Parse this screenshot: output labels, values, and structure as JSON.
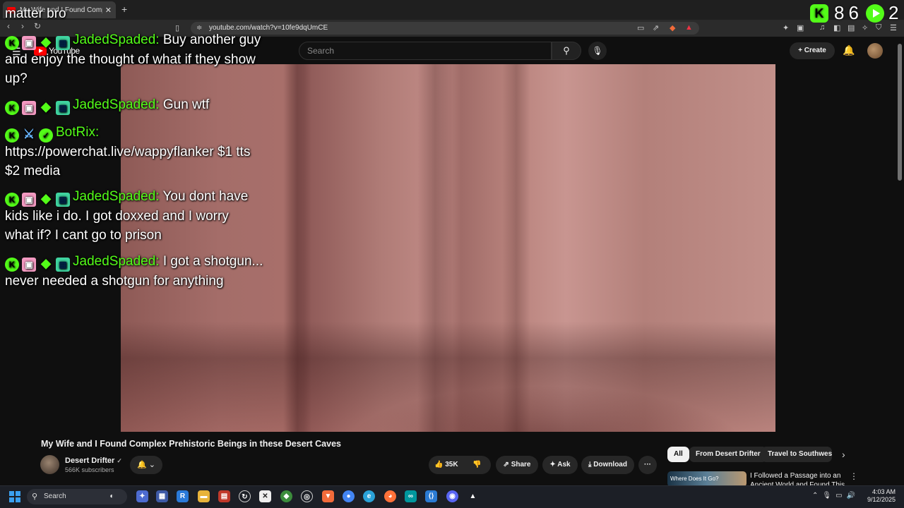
{
  "browser": {
    "tab_title": "My Wife and I Found Comple",
    "tab_close": "✕",
    "new_tab": "+",
    "url": "youtube.com/watch?v=10fe9dqUmCE",
    "back": "‹",
    "forward": "›",
    "reload": "↻",
    "extension_badge": "1"
  },
  "youtube": {
    "logo_text": "YouTube",
    "search_placeholder": "Search",
    "create_label": "Create",
    "video_title": "My Wife and I Found Complex Prehistoric Beings in these Desert Caves",
    "channel_name": "Desert Drifter",
    "verified": "✓",
    "subscribers": "566K subscribers",
    "likes": "35K",
    "share_label": "Share",
    "ask_label": "Ask",
    "download_label": "Download",
    "more_label": "···",
    "chips": [
      "All",
      "From Desert Drifter",
      "Travel to Southwestern"
    ],
    "chip_next": "›",
    "rec_thumb_text": "Where Does It Go?",
    "rec_title": "I Followed a Passage into an Ancient World and Found This"
  },
  "overlay": {
    "partial_top": "matter bro",
    "counter_left": "8",
    "counter_mid": "6",
    "counter_right": "2",
    "messages": [
      {
        "user": "JadedSpaded:",
        "text": "Buy another guy",
        "cont": "and enjoy the thought of what if they show",
        "cont2": "up?"
      },
      {
        "user": "JadedSpaded:",
        "text": "Gun wtf"
      },
      {
        "user": "BotRix:",
        "cont": "https://powerchat.live/wappyflanker $1 tts",
        "cont2": "$2 media"
      },
      {
        "user": "JadedSpaded:",
        "text": "You dont have",
        "cont": "kids like i do. I got doxxed and I worry",
        "cont2": "what if? I cant go to prison"
      },
      {
        "user": "JadedSpaded:",
        "text": "I got a shotgun...",
        "cont": "never needed a shotgun for anything"
      }
    ]
  },
  "taskbar": {
    "search_label": "Search",
    "time": "4:03 AM",
    "date": "9/12/2025"
  },
  "colors": {
    "kick_green": "#53fc18",
    "youtube_red": "#ff0000",
    "bg": "#0f0f0f"
  }
}
